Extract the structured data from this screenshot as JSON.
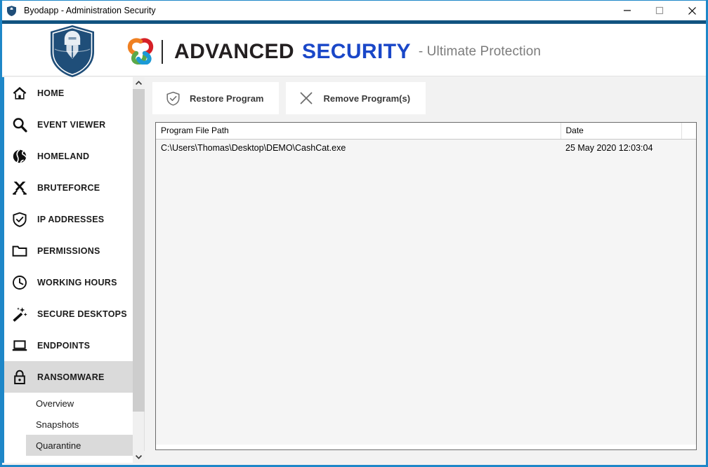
{
  "window": {
    "title": "Byodapp - Administration Security",
    "icon": "shield-icon",
    "minimize_label": "Minimize",
    "maximize_label": "Maximize",
    "close_label": "Close",
    "accent_color": "#1e87c8",
    "header_band_color": "#115380"
  },
  "header": {
    "logo": "knight-shield-logo",
    "swirl": "swirl-logo",
    "brand_first": "ADVANCED",
    "brand_second": "SECURITY",
    "tagline": "- Ultimate Protection",
    "brand_first_color": "#231f20",
    "brand_second_color": "#1a47c8",
    "tagline_color": "#7c7c7c"
  },
  "sidebar": {
    "items": [
      {
        "label": "HOME",
        "icon": "home-icon",
        "active": false
      },
      {
        "label": "EVENT VIEWER",
        "icon": "search-icon",
        "active": false
      },
      {
        "label": "HOMELAND",
        "icon": "globe-icon",
        "active": false
      },
      {
        "label": "BRUTEFORCE",
        "icon": "crossed-swords-icon",
        "active": false
      },
      {
        "label": "IP ADDRESSES",
        "icon": "shield-check-icon",
        "active": false
      },
      {
        "label": "PERMISSIONS",
        "icon": "folder-icon",
        "active": false
      },
      {
        "label": "WORKING HOURS",
        "icon": "clock-icon",
        "active": false
      },
      {
        "label": "SECURE DESKTOPS",
        "icon": "magic-wand-icon",
        "active": false
      },
      {
        "label": "ENDPOINTS",
        "icon": "laptop-icon",
        "active": false
      },
      {
        "label": "RANSOMWARE",
        "icon": "lock-icon",
        "active": true
      }
    ],
    "subitems": [
      {
        "label": "Overview",
        "selected": false
      },
      {
        "label": "Snapshots",
        "selected": false
      },
      {
        "label": "Quarantine",
        "selected": true
      }
    ],
    "scroll_up_label": "Scroll up",
    "scroll_down_label": "Scroll down",
    "active_bg": "#dadada"
  },
  "toolbar": {
    "restore_label": "Restore Program",
    "restore_icon": "shield-check-icon",
    "remove_label": "Remove Program(s)",
    "remove_icon": "close-x-icon"
  },
  "table": {
    "columns": [
      "Program File Path",
      "Date",
      ""
    ],
    "rows": [
      {
        "path": "C:\\Users\\Thomas\\Desktop\\DEMO\\CashCat.exe",
        "date": "25 May 2020 12:03:04",
        "extra": ""
      }
    ]
  }
}
